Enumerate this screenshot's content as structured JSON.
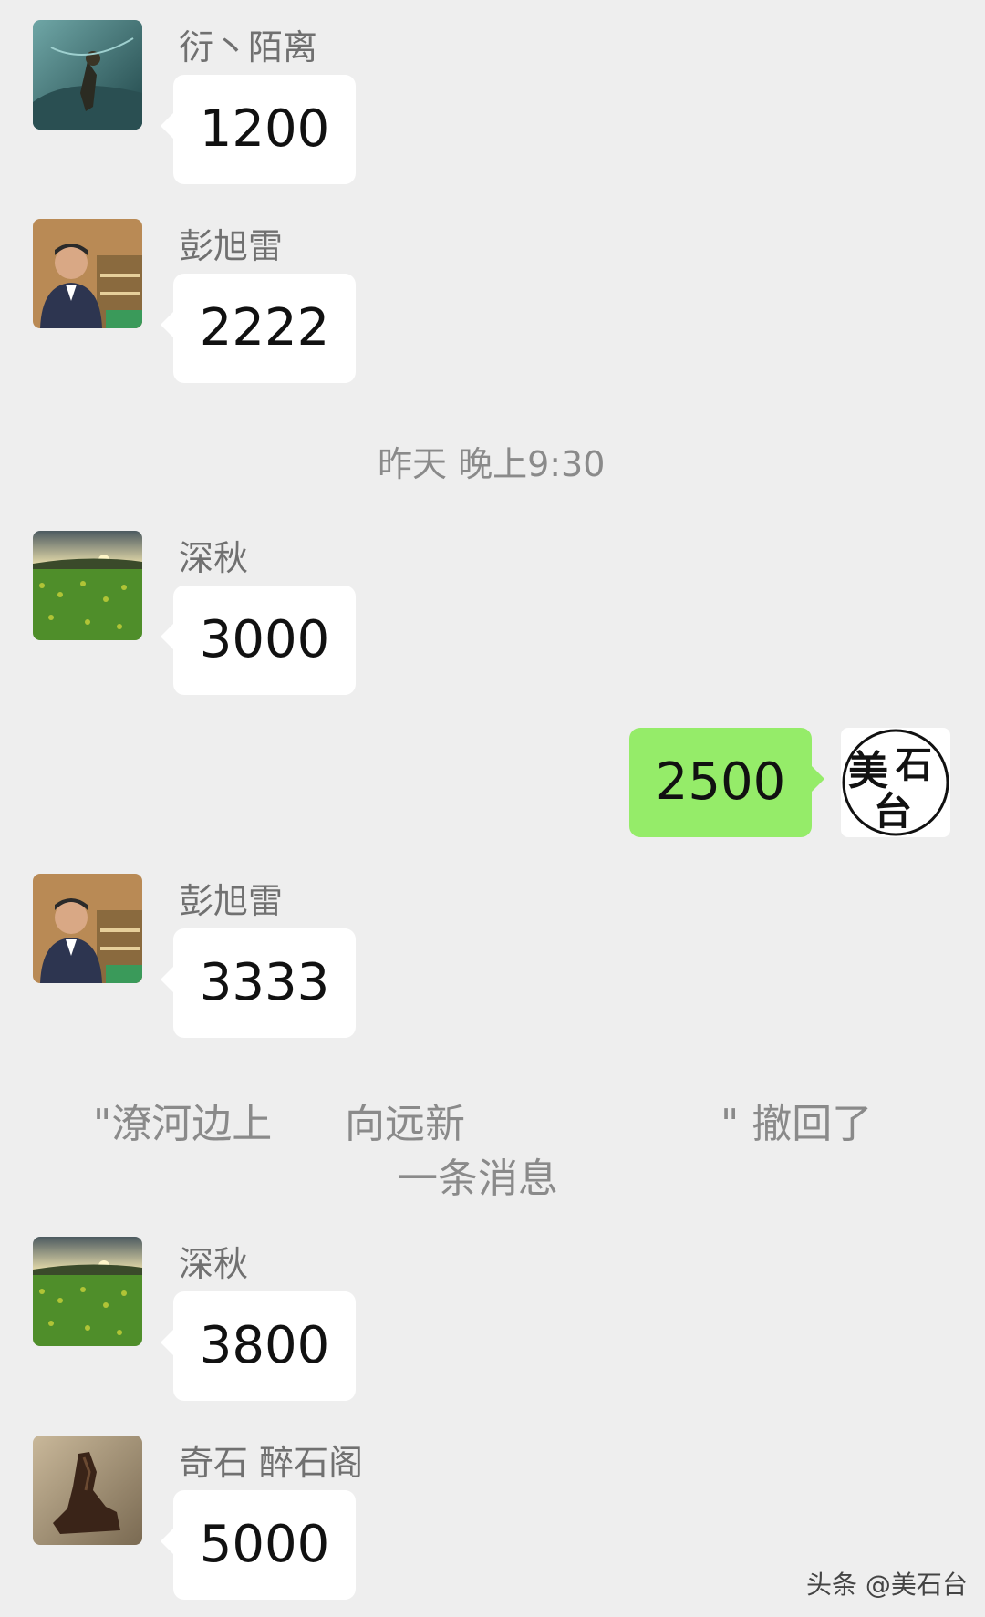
{
  "messages": [
    {
      "sender": "衍丶陌离",
      "text": "1200",
      "avatar": "dark-teal-figure-avatar"
    },
    {
      "sender": "彭旭雷",
      "text": "2222",
      "avatar": "man-portrait-avatar"
    },
    {
      "sender": "深秋",
      "text": "3000",
      "avatar": "field-landscape-avatar"
    },
    {
      "sender": "美石台",
      "text": "2500",
      "avatar": "calligraphy-logo-avatar",
      "mine": true
    },
    {
      "sender": "彭旭雷",
      "text": "3333",
      "avatar": "man-portrait-avatar"
    },
    {
      "sender": "深秋",
      "text": "3800",
      "avatar": "field-landscape-avatar"
    },
    {
      "sender": "奇石 醉石阁",
      "text": "5000",
      "avatar": "rock-sculpture-avatar"
    }
  ],
  "timestamp": "昨天 晚上9:30",
  "recall_notice": {
    "part1": "\"潦河边上",
    "part2": "向远新",
    "part3": "\" 撤回了",
    "line2": "一条消息"
  },
  "logo_text": "美石台",
  "watermark": "头条 @美石台",
  "colors": {
    "background": "#eeeeee",
    "bubble_other": "#ffffff",
    "bubble_mine": "#95ec69"
  }
}
